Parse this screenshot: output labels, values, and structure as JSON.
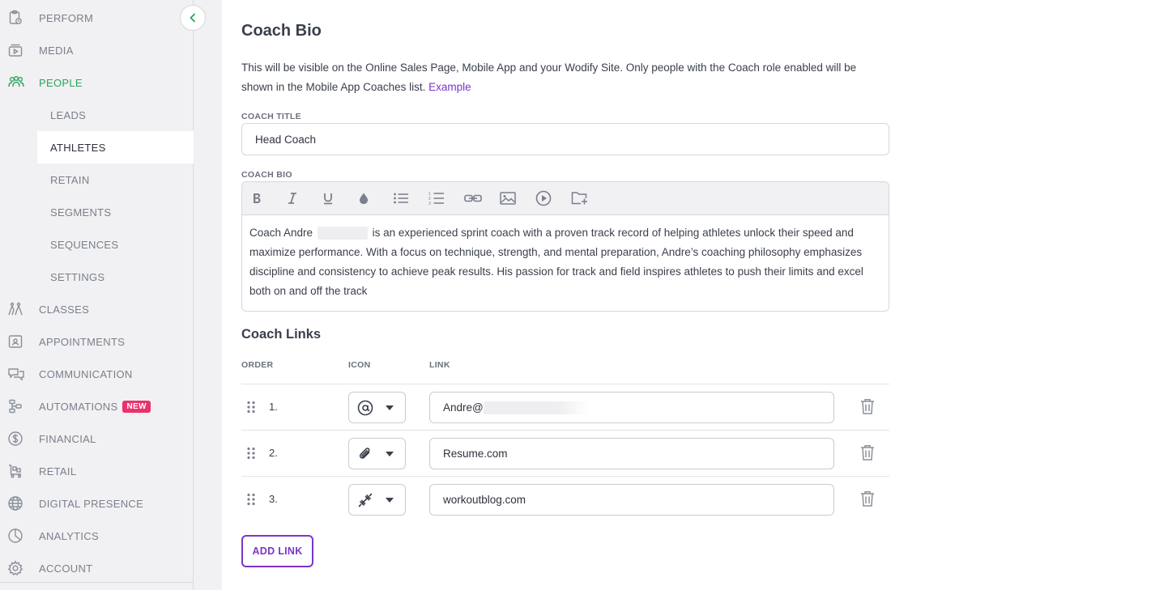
{
  "sidebar": {
    "items": [
      {
        "label": "PERFORM",
        "icon": "clipboard-icon"
      },
      {
        "label": "MEDIA",
        "icon": "media-icon"
      },
      {
        "label": "PEOPLE",
        "icon": "people-icon"
      },
      {
        "label": "CLASSES",
        "icon": "classes-icon"
      },
      {
        "label": "APPOINTMENTS",
        "icon": "appointments-icon"
      },
      {
        "label": "COMMUNICATION",
        "icon": "chat-icon"
      },
      {
        "label": "AUTOMATIONS",
        "icon": "automations-icon",
        "badge": "NEW"
      },
      {
        "label": "FINANCIAL",
        "icon": "dollar-icon"
      },
      {
        "label": "RETAIL",
        "icon": "cart-icon"
      },
      {
        "label": "DIGITAL PRESENCE",
        "icon": "globe-icon"
      },
      {
        "label": "ANALYTICS",
        "icon": "pie-icon"
      },
      {
        "label": "ACCOUNT",
        "icon": "gear-icon"
      }
    ],
    "sub_items": [
      {
        "label": "LEADS"
      },
      {
        "label": "ATHLETES"
      },
      {
        "label": "RETAIN"
      },
      {
        "label": "SEGMENTS"
      },
      {
        "label": "SEQUENCES"
      },
      {
        "label": "SETTINGS"
      }
    ],
    "active_parent": "PEOPLE",
    "active_sub": "ATHLETES"
  },
  "main": {
    "title": "Coach Bio",
    "description": "This will be visible on the Online Sales Page, Mobile App and your Wodify Site. Only people with the Coach role enabled will be shown in the Mobile App Coaches list.",
    "example_link": "Example",
    "coach_title_label": "COACH TITLE",
    "coach_title_value": "Head Coach",
    "coach_bio_label": "COACH BIO",
    "bio_part1": "Coach Andre",
    "bio_part2": "is an experienced sprint coach with a proven track record of helping athletes unlock their speed and maximize performance. With a focus on technique, strength, and mental preparation, Andre’s coaching philosophy emphasizes discipline and consistency to achieve peak results. His passion for track and field inspires athletes to push their limits and excel both on and off the track",
    "links_title": "Coach Links",
    "columns": {
      "order": "ORDER",
      "icon": "ICON",
      "link": "LINK"
    },
    "links": [
      {
        "order": "1.",
        "icon": "at-sign-icon",
        "value": "Andre@"
      },
      {
        "order": "2.",
        "icon": "paperclip-icon",
        "value": "Resume.com"
      },
      {
        "order": "3.",
        "icon": "dumbbell-icon",
        "value": "workoutblog.com"
      }
    ],
    "add_link_label": "ADD LINK"
  },
  "colors": {
    "accent": "#7a35c9",
    "active_green": "#2aa45c",
    "badge": "#e8336d"
  }
}
